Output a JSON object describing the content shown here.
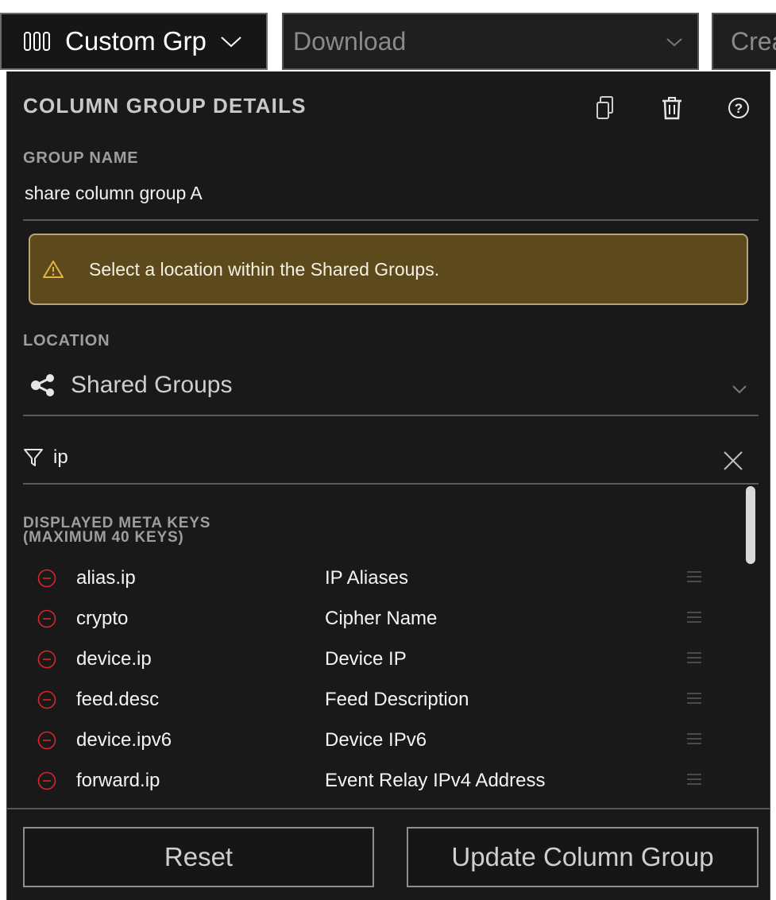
{
  "toolbar": {
    "column_group_label": "Custom Grp",
    "download_label": "Download",
    "create_label": "Crea"
  },
  "panel": {
    "title": "COLUMN GROUP DETAILS",
    "group_name_label": "GROUP NAME",
    "group_name_value": "share column group A",
    "warning_text": "Select a location within the Shared Groups.",
    "location_label": "LOCATION",
    "location_value": "Shared Groups",
    "filter_value": "ip",
    "keys_header_line1": "DISPLAYED META KEYS",
    "keys_header_line2": "(MAXIMUM 40 KEYS)",
    "meta_keys": [
      {
        "key": "alias.ip",
        "desc": "IP Aliases"
      },
      {
        "key": "crypto",
        "desc": "Cipher Name"
      },
      {
        "key": "device.ip",
        "desc": "Device IP"
      },
      {
        "key": "feed.desc",
        "desc": "Feed Description"
      },
      {
        "key": "device.ipv6",
        "desc": "Device IPv6"
      },
      {
        "key": "forward.ip",
        "desc": "Event Relay IPv4 Address"
      }
    ],
    "reset_label": "Reset",
    "update_label": "Update Column Group"
  },
  "colors": {
    "panel_bg": "#191919",
    "warning_bg": "#5c4a1c",
    "warning_icon": "#e3b43b",
    "remove_icon": "#d9262b"
  },
  "icons": [
    "columns-icon",
    "chevron-down-icon",
    "copy-icon",
    "trash-icon",
    "help-icon",
    "warning-icon",
    "share-icon",
    "filter-icon",
    "close-icon",
    "remove-icon",
    "drag-handle-icon"
  ]
}
